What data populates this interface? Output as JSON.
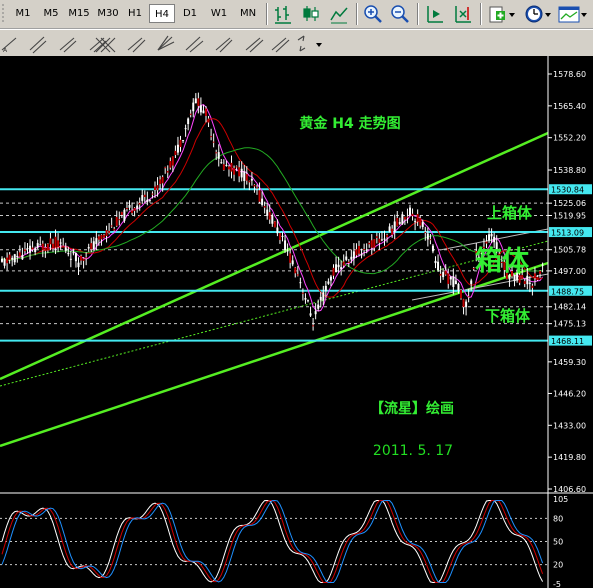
{
  "toolbar": {
    "timeframes": [
      "M1",
      "M5",
      "M15",
      "M30",
      "H1",
      "H4",
      "D1",
      "W1",
      "MN"
    ],
    "active_timeframe": "H4"
  },
  "chart_data": {
    "type": "candlestick",
    "instrument_title": "黄金  H4  走势图",
    "annotations": {
      "upper_box": "上箱体",
      "box": "箱体",
      "lower_box": "下箱体",
      "author": "【流星】绘画",
      "date": "2011. 5. 17"
    },
    "price_ticks": [
      "1578.60",
      "1565.40",
      "1552.20",
      "1538.80",
      "1525.06",
      "1519.95",
      "1505.78",
      "1497.00",
      "1482.14",
      "1475.13",
      "1459.30",
      "1446.20",
      "1433.00",
      "1419.80",
      "1406.60"
    ],
    "highlighted_levels": [
      "1530.84",
      "1513.09",
      "1488.75",
      "1468.11"
    ],
    "oscillator_ticks": [
      "105",
      "80",
      "50",
      "20",
      "-5"
    ],
    "indicator_colors": {
      "price_level": "#44e8f0",
      "channel": "#55ee22",
      "annotation": "#33ee33",
      "date": "#22dd22"
    },
    "axis_ylim": [
      1406.6,
      1578.6
    ]
  }
}
